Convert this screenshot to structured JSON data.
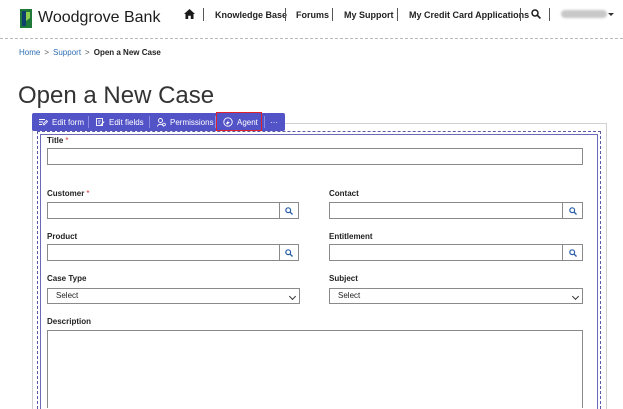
{
  "header": {
    "brand": "Woodgrove Bank",
    "logo_icon": "woodgrove-logo-icon",
    "nav": [
      {
        "label": "Knowledge Base"
      },
      {
        "label": "Forums"
      },
      {
        "label": "My Support"
      },
      {
        "label": "My Credit Card Applications"
      }
    ],
    "home_icon": "home-icon",
    "search_icon": "search-icon"
  },
  "breadcrumb": {
    "items": [
      "Home",
      "Support"
    ],
    "separator": ">",
    "current": "Open a New Case"
  },
  "page": {
    "title": "Open a New Case"
  },
  "toolbar": {
    "accent": "#5353c8",
    "highlight_color": "#e0202a",
    "buttons": [
      {
        "label": "Edit form",
        "icon": "edit-form-icon"
      },
      {
        "label": "Edit fields",
        "icon": "edit-fields-icon"
      },
      {
        "label": "Permissions",
        "icon": "permissions-icon"
      },
      {
        "label": "Agent",
        "icon": "agent-icon"
      },
      {
        "label": "···",
        "icon": "more-icon"
      }
    ]
  },
  "form": {
    "title_label": "Title",
    "required_marker": "*",
    "customer_label": "Customer",
    "contact_label": "Contact",
    "product_label": "Product",
    "entitlement_label": "Entitlement",
    "case_type_label": "Case Type",
    "case_type_value": "Select",
    "subject_label": "Subject",
    "subject_value": "Select",
    "description_label": "Description"
  }
}
